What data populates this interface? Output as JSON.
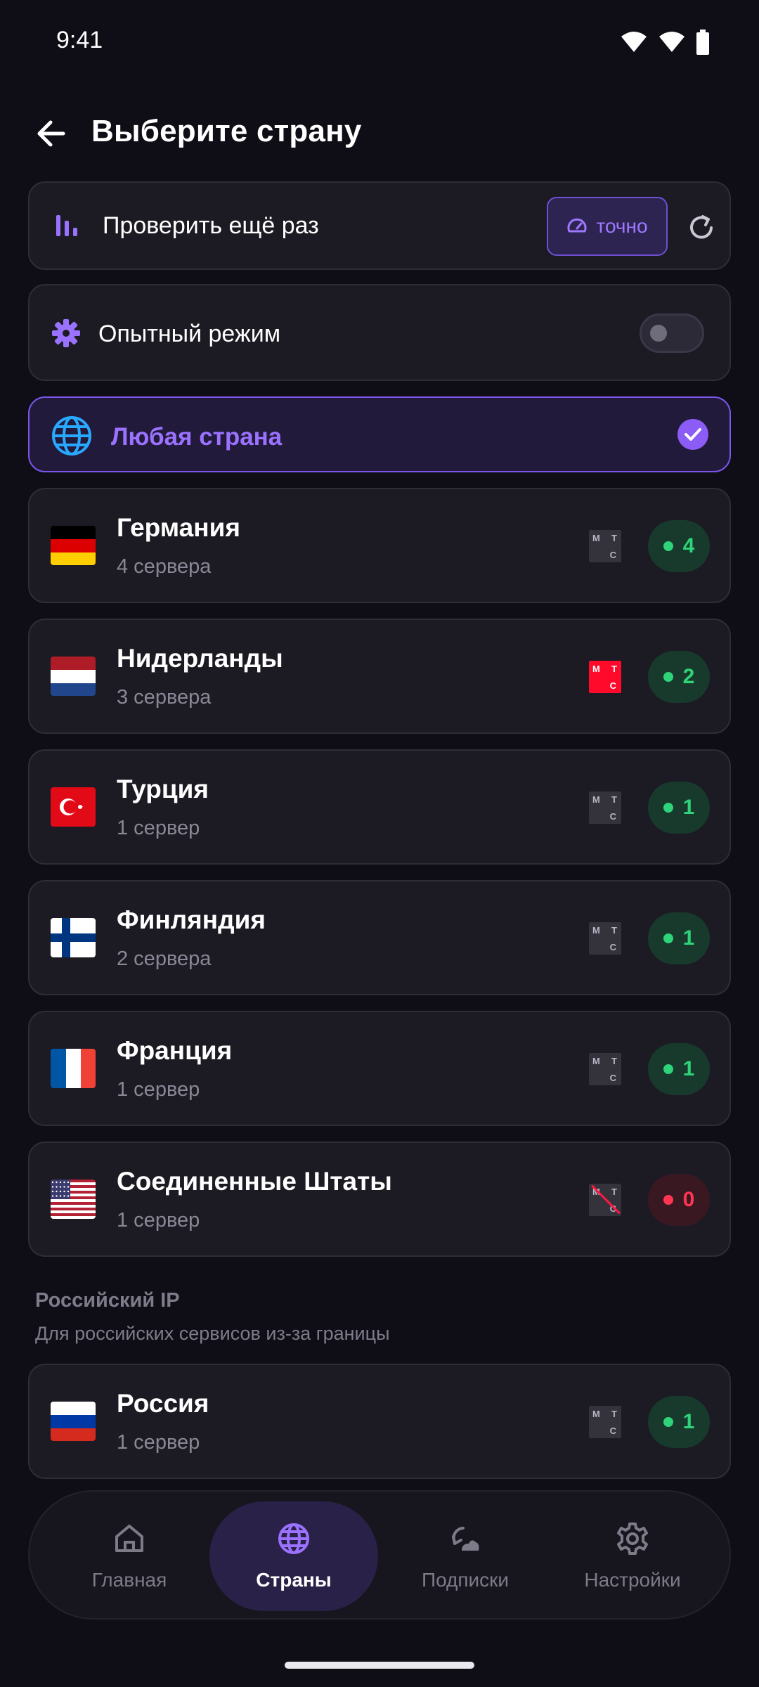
{
  "status_bar": {
    "time": "9:41"
  },
  "header": {
    "title": "Выберите страну"
  },
  "check": {
    "label": "Проверить ещё раз",
    "mode_label": "точно"
  },
  "experimental": {
    "label": "Опытный режим",
    "enabled": false
  },
  "any_country": {
    "label": "Любая страна",
    "selected": true
  },
  "countries": [
    {
      "name": "Германия",
      "servers": "4 сервера",
      "count": "4",
      "flag": "de",
      "mts": "gray",
      "status": "online"
    },
    {
      "name": "Нидерланды",
      "servers": "3 сервера",
      "count": "2",
      "flag": "nl",
      "mts": "red",
      "status": "online"
    },
    {
      "name": "Турция",
      "servers": "1 сервер",
      "count": "1",
      "flag": "tr",
      "mts": "gray",
      "status": "online"
    },
    {
      "name": "Финляндия",
      "servers": "2 сервера",
      "count": "1",
      "flag": "fi",
      "mts": "gray",
      "status": "online"
    },
    {
      "name": "Франция",
      "servers": "1 сервер",
      "count": "1",
      "flag": "fr",
      "mts": "gray",
      "status": "online"
    },
    {
      "name": "Соединенные Штаты",
      "servers": "1 сервер",
      "count": "0",
      "flag": "us",
      "mts": "blocked",
      "status": "offline"
    }
  ],
  "mts_logo": {
    "m": "М",
    "t": "Т",
    "c": "С"
  },
  "russian_section": {
    "title": "Российский IP",
    "subtitle": "Для российских сервисов из-за границы"
  },
  "russia": {
    "name": "Россия",
    "servers": "1 сервер",
    "count": "1",
    "flag": "ru",
    "mts": "gray",
    "status": "online"
  },
  "nav": {
    "items": [
      {
        "label": "Главная",
        "icon": "home-icon",
        "active": false
      },
      {
        "label": "Страны",
        "icon": "globe-icon",
        "active": true
      },
      {
        "label": "Подписки",
        "icon": "subscriptions-icon",
        "active": false
      },
      {
        "label": "Настройки",
        "icon": "gear-icon",
        "active": false
      }
    ]
  },
  "colors": {
    "accent": "#8b5cf6",
    "online": "#2fd37a",
    "offline": "#ff3553",
    "mts_red": "#ff0a2b"
  }
}
